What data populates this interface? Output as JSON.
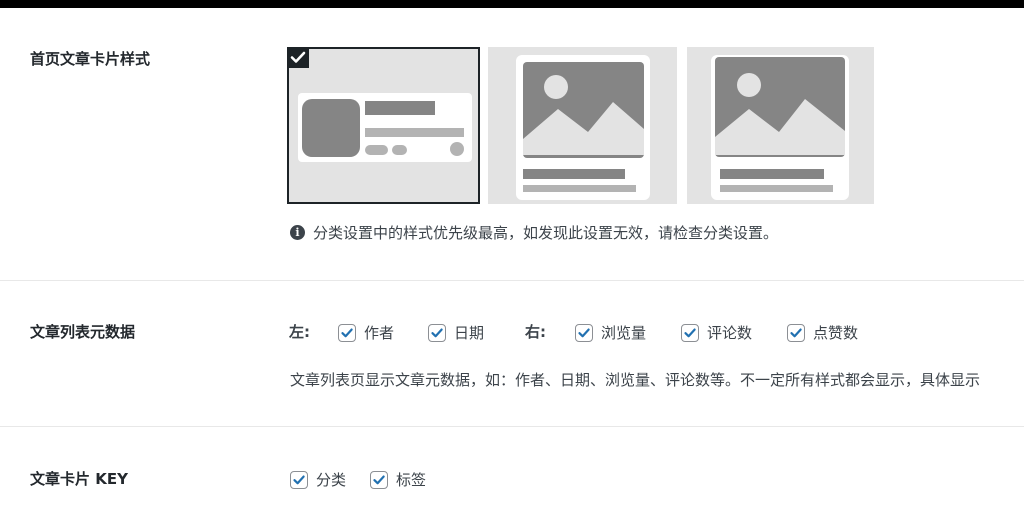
{
  "sections": {
    "card_style": {
      "label": "首页文章卡片样式",
      "options": [
        {
          "name": "list-card",
          "selected": true
        },
        {
          "name": "image-card-a",
          "selected": false
        },
        {
          "name": "image-card-b",
          "selected": false
        }
      ],
      "notice": "分类设置中的样式优先级最高，如发现此设置无效，请检查分类设置。",
      "notice_icon": "info-icon"
    },
    "meta_data": {
      "label": "文章列表元数据",
      "left_label": "左:",
      "right_label": "右:",
      "left_items": [
        {
          "label": "作者",
          "checked": true
        },
        {
          "label": "日期",
          "checked": true
        }
      ],
      "right_items": [
        {
          "label": "浏览量",
          "checked": true
        },
        {
          "label": "评论数",
          "checked": true
        },
        {
          "label": "点赞数",
          "checked": true
        }
      ],
      "description": "文章列表页显示文章元数据，如：作者、日期、浏览量、评论数等。不一定所有样式都会显示，具体显示"
    },
    "card_key": {
      "label": "文章卡片 KEY",
      "items": [
        {
          "label": "分类",
          "checked": true
        },
        {
          "label": "标签",
          "checked": true
        }
      ]
    }
  },
  "colors": {
    "accent": "#2271b1",
    "option_bg": "#e3e3e3",
    "selected_border": "#1d2327"
  }
}
